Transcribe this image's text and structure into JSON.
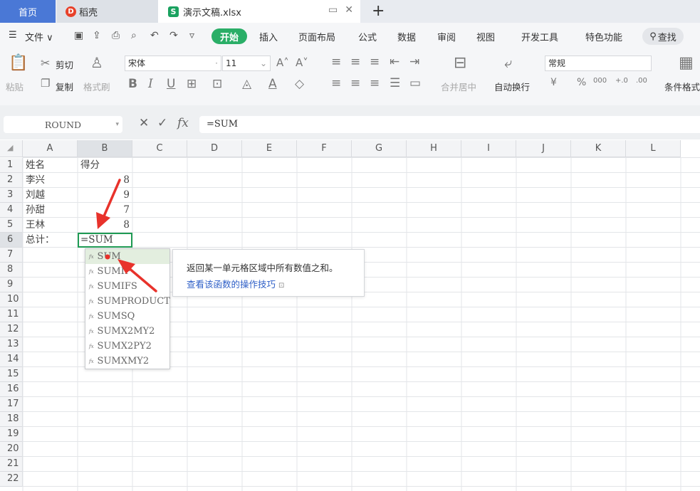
{
  "tabs": {
    "home": "首页",
    "daoke": "稻壳",
    "file": "演示文稿.xlsx",
    "new_tab": "+"
  },
  "menu": {
    "file": "文件",
    "items": [
      "开始",
      "插入",
      "页面布局",
      "公式",
      "数据",
      "审阅",
      "视图",
      "开发工具",
      "特色功能"
    ],
    "search": "查找"
  },
  "ribbon": {
    "paste": "粘贴",
    "cut": "剪切",
    "copy": "复制",
    "format_painter": "格式刷",
    "font_name": "宋体",
    "font_size": "11",
    "merge_center": "合并居中",
    "wrap_text": "自动换行",
    "number_format": "常规",
    "conditional_format": "条件格式",
    "bold": "B",
    "italic": "I",
    "underline": "U",
    "num_symbols": [
      "¥",
      "%",
      "000",
      "+.0",
      ".00"
    ]
  },
  "formula_bar": {
    "name_box": "ROUND",
    "fx": "fx",
    "value": "=SUM"
  },
  "columns": [
    "A",
    "B",
    "C",
    "D",
    "E",
    "F",
    "G",
    "H",
    "I",
    "J",
    "K",
    "L"
  ],
  "rows": [
    "1",
    "2",
    "3",
    "4",
    "5",
    "6",
    "7",
    "8",
    "9",
    "10",
    "11",
    "12",
    "13",
    "14",
    "15",
    "16",
    "17",
    "18",
    "19",
    "20",
    "21",
    "22"
  ],
  "cells": {
    "A1": "姓名",
    "B1": "得分",
    "A2": "李兴",
    "B2": "8",
    "A3": "刘越",
    "B3": "9",
    "A4": "孙甜",
    "B4": "7",
    "A5": "王林",
    "B5": "8",
    "A6": "总计：",
    "B6": "=SUM"
  },
  "autocomplete": {
    "items": [
      "SUM",
      "SUMIF",
      "SUMIFS",
      "SUMPRODUCT",
      "SUMSQ",
      "SUMX2MY2",
      "SUMX2PY2",
      "SUMXMY2"
    ],
    "selected_index": 0,
    "description": "返回某一单元格区域中所有数值之和。",
    "link": "查看该函数的操作技巧"
  },
  "colors": {
    "accent_green": "#2aae67",
    "active_border": "#1f9b54",
    "home_tab": "#4a78d6",
    "arrow_red": "#e8322b"
  }
}
